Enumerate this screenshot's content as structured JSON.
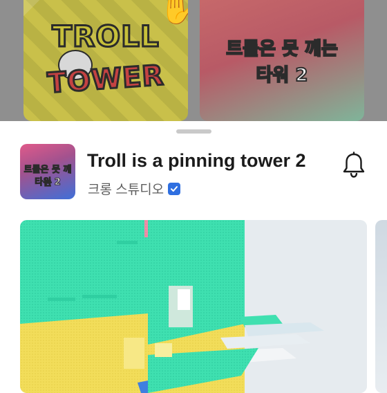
{
  "background_cards": [
    {
      "title_line_1": "TROLL",
      "title_line_2": "TOWER"
    },
    {
      "title_line_1": "트롤은 못 깨는",
      "title_line_2": "타워 2"
    }
  ],
  "game": {
    "title": "Troll is a pinning tower 2",
    "creator": "크롱 스튜디오",
    "verified": true,
    "thumb_line_1": "트롤은 못 깨는",
    "thumb_line_2": "타워 2"
  },
  "icons": {
    "notify": "bell-icon",
    "verified": "verified-check-icon"
  },
  "colors": {
    "verified_badge": "#2f6fe0",
    "title_text": "#1b1b1b",
    "creator_text": "#5e5e5e"
  }
}
